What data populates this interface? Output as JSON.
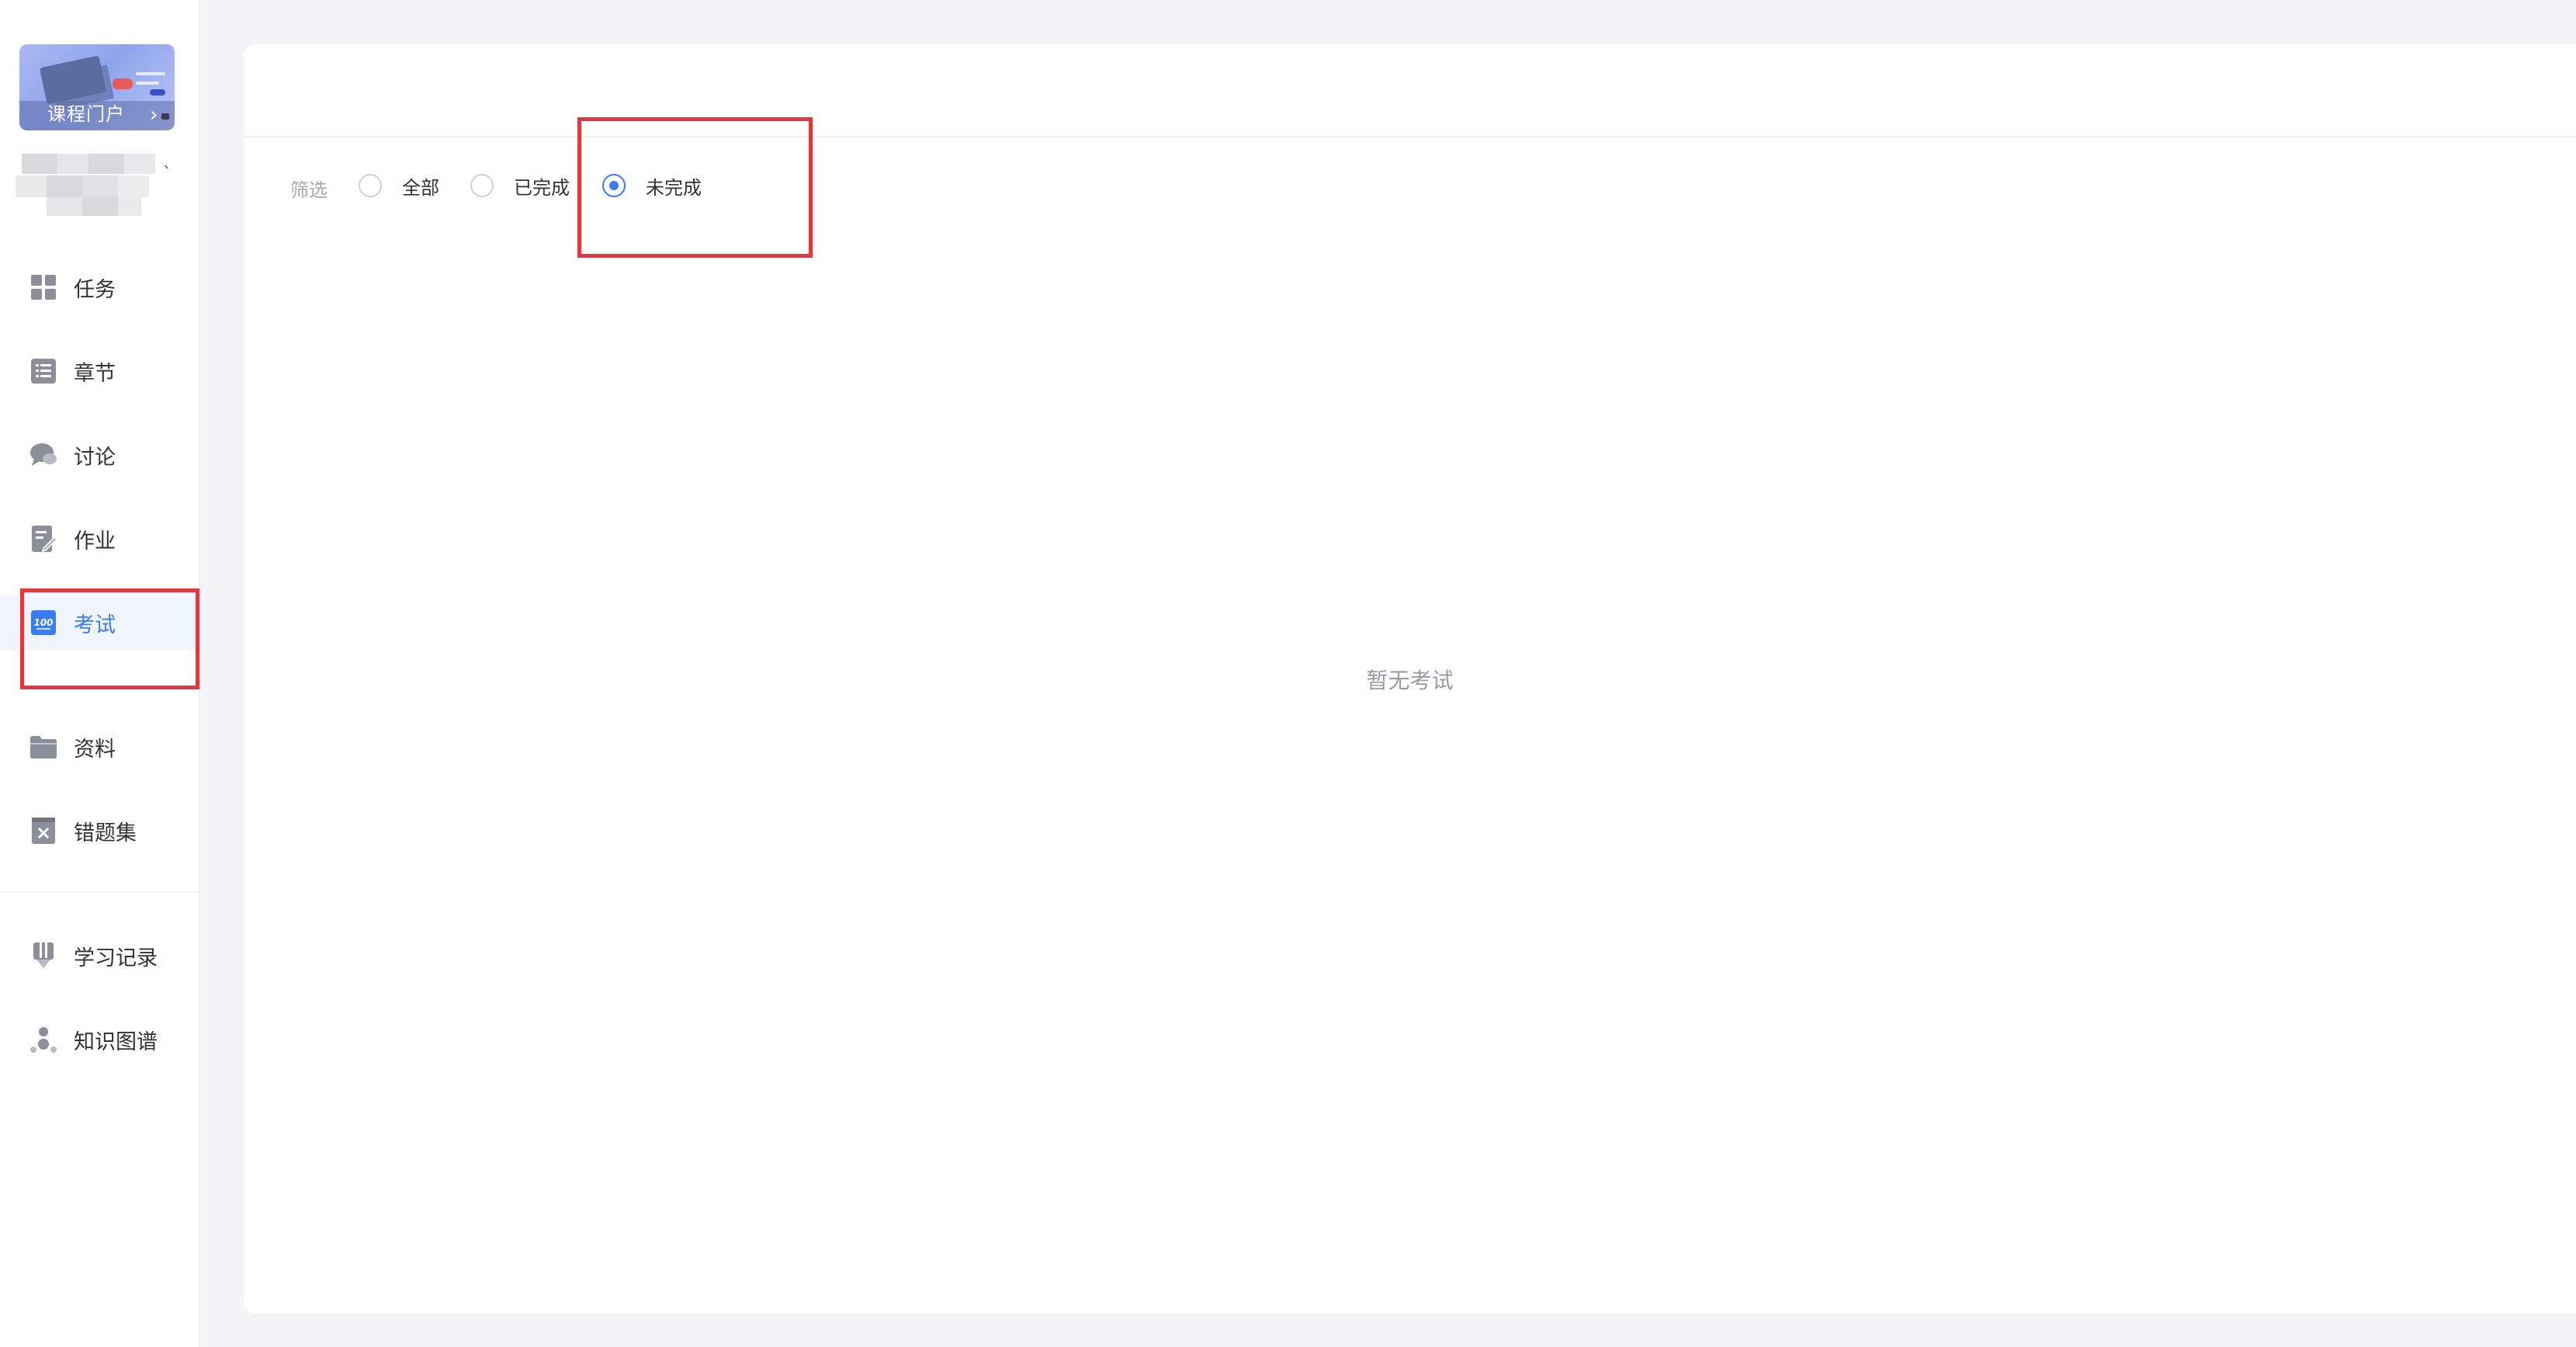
{
  "course_card": {
    "label": "课程门户"
  },
  "sidebar": {
    "items": [
      {
        "label": "任务",
        "icon": "grid-icon"
      },
      {
        "label": "章节",
        "icon": "list-icon"
      },
      {
        "label": "讨论",
        "icon": "chat-bubble-icon"
      },
      {
        "label": "作业",
        "icon": "edit-document-icon"
      },
      {
        "label": "考试",
        "icon": "exam-100-icon",
        "active": true
      },
      {
        "label": "资料",
        "icon": "folder-icon"
      },
      {
        "label": "错题集",
        "icon": "wrong-question-icon"
      },
      {
        "label": "学习记录",
        "icon": "bookmark-record-icon"
      },
      {
        "label": "知识图谱",
        "icon": "knowledge-graph-icon"
      }
    ]
  },
  "filter": {
    "label": "筛选",
    "options": [
      {
        "label": "全部",
        "checked": false
      },
      {
        "label": "已完成",
        "checked": false
      },
      {
        "label": "未完成",
        "checked": true
      }
    ]
  },
  "empty_state": {
    "text": "暂无考试"
  },
  "colors": {
    "accent": "#3a7bf6",
    "annotation": "#e0383e",
    "background": "#f3f4f8"
  }
}
